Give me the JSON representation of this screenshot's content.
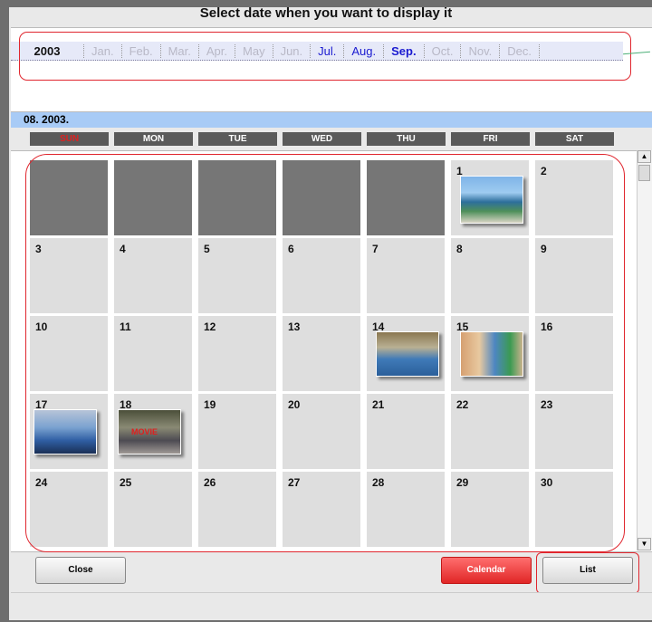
{
  "title": "Select date when you want to display it",
  "year_bar": {
    "year": "2003",
    "months": [
      {
        "label": "Jan.",
        "state": "inactive"
      },
      {
        "label": "Feb.",
        "state": "inactive"
      },
      {
        "label": "Mar.",
        "state": "inactive"
      },
      {
        "label": "Apr.",
        "state": "inactive"
      },
      {
        "label": "May",
        "state": "inactive"
      },
      {
        "label": "Jun.",
        "state": "inactive"
      },
      {
        "label": "Jul.",
        "state": "active"
      },
      {
        "label": "Aug.",
        "state": "active"
      },
      {
        "label": "Sep.",
        "state": "current"
      },
      {
        "label": "Oct.",
        "state": "inactive"
      },
      {
        "label": "Nov.",
        "state": "inactive"
      },
      {
        "label": "Dec.",
        "state": "inactive"
      }
    ]
  },
  "month_label": "08. 2003.",
  "weekdays": [
    "SUN",
    "MON",
    "TUE",
    "WED",
    "THU",
    "FRI",
    "SAT"
  ],
  "calendar": {
    "leading_blanks": 5,
    "days": [
      "1",
      "2",
      "3",
      "4",
      "5",
      "6",
      "7",
      "8",
      "9",
      "10",
      "11",
      "12",
      "13",
      "14",
      "15",
      "16",
      "17",
      "18",
      "19",
      "20",
      "21",
      "22",
      "23",
      "24",
      "25",
      "26",
      "27",
      "28",
      "29",
      "30"
    ],
    "photo_days": [
      "1",
      "14",
      "15",
      "17",
      "18"
    ],
    "movie_day": "18",
    "movie_tag": "MOVIE"
  },
  "buttons": {
    "close": "Close",
    "calendar": "Calendar",
    "list": "List"
  },
  "colors": {
    "accent_red": "#e02626",
    "month_label_bg": "#a8cbf6",
    "highlight_box": "#e0262e"
  }
}
